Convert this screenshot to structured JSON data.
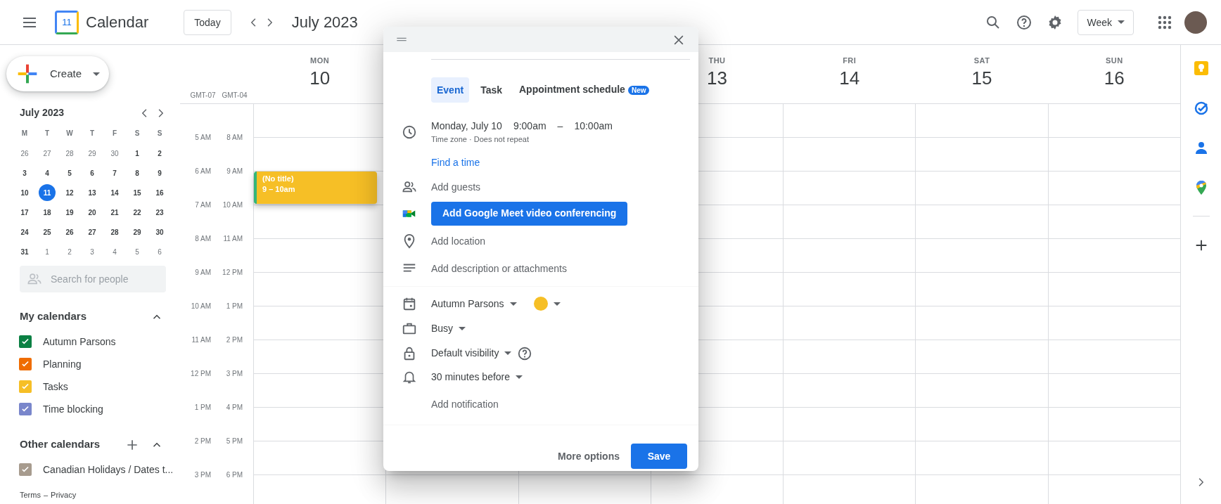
{
  "header": {
    "title": "Calendar",
    "logo_number": "11",
    "today": "Today",
    "period": "July 2023",
    "view": "Week"
  },
  "sidebar": {
    "create": "Create",
    "mini_calendar": {
      "title": "July 2023",
      "weekdays": [
        "M",
        "T",
        "W",
        "T",
        "F",
        "S",
        "S"
      ],
      "weeks": [
        [
          {
            "d": "26",
            "other_month": true,
            "selected": false
          },
          {
            "d": "27",
            "other_month": true,
            "selected": false
          },
          {
            "d": "28",
            "other_month": true,
            "selected": false
          },
          {
            "d": "29",
            "other_month": true,
            "selected": false
          },
          {
            "d": "30",
            "other_month": true,
            "selected": false
          },
          {
            "d": "1",
            "other_month": false,
            "selected": false
          },
          {
            "d": "2",
            "other_month": false,
            "selected": false
          }
        ],
        [
          {
            "d": "3",
            "other_month": false,
            "selected": false
          },
          {
            "d": "4",
            "other_month": false,
            "selected": false
          },
          {
            "d": "5",
            "other_month": false,
            "selected": false
          },
          {
            "d": "6",
            "other_month": false,
            "selected": false
          },
          {
            "d": "7",
            "other_month": false,
            "selected": false
          },
          {
            "d": "8",
            "other_month": false,
            "selected": false
          },
          {
            "d": "9",
            "other_month": false,
            "selected": false
          }
        ],
        [
          {
            "d": "10",
            "other_month": false,
            "selected": false
          },
          {
            "d": "11",
            "other_month": false,
            "selected": true
          },
          {
            "d": "12",
            "other_month": false,
            "selected": false
          },
          {
            "d": "13",
            "other_month": false,
            "selected": false
          },
          {
            "d": "14",
            "other_month": false,
            "selected": false
          },
          {
            "d": "15",
            "other_month": false,
            "selected": false
          },
          {
            "d": "16",
            "other_month": false,
            "selected": false
          }
        ],
        [
          {
            "d": "17",
            "other_month": false,
            "selected": false
          },
          {
            "d": "18",
            "other_month": false,
            "selected": false
          },
          {
            "d": "19",
            "other_month": false,
            "selected": false
          },
          {
            "d": "20",
            "other_month": false,
            "selected": false
          },
          {
            "d": "21",
            "other_month": false,
            "selected": false
          },
          {
            "d": "22",
            "other_month": false,
            "selected": false
          },
          {
            "d": "23",
            "other_month": false,
            "selected": false
          }
        ],
        [
          {
            "d": "24",
            "other_month": false,
            "selected": false
          },
          {
            "d": "25",
            "other_month": false,
            "selected": false
          },
          {
            "d": "26",
            "other_month": false,
            "selected": false
          },
          {
            "d": "27",
            "other_month": false,
            "selected": false
          },
          {
            "d": "28",
            "other_month": false,
            "selected": false
          },
          {
            "d": "29",
            "other_month": false,
            "selected": false
          },
          {
            "d": "30",
            "other_month": false,
            "selected": false
          }
        ],
        [
          {
            "d": "31",
            "other_month": false,
            "selected": false
          },
          {
            "d": "1",
            "other_month": true,
            "selected": false
          },
          {
            "d": "2",
            "other_month": true,
            "selected": false
          },
          {
            "d": "3",
            "other_month": true,
            "selected": false
          },
          {
            "d": "4",
            "other_month": true,
            "selected": false
          },
          {
            "d": "5",
            "other_month": true,
            "selected": false
          },
          {
            "d": "6",
            "other_month": true,
            "selected": false
          }
        ]
      ]
    },
    "search": {
      "placeholder": "Search for people"
    },
    "my_calendars": {
      "title": "My calendars",
      "expanded": true,
      "items": [
        {
          "label": "Autumn Parsons",
          "checked": true,
          "color": "#0b8043"
        },
        {
          "label": "Planning",
          "checked": true,
          "color": "#ef6c00"
        },
        {
          "label": "Tasks",
          "checked": true,
          "color": "#f6bf26"
        },
        {
          "label": "Time blocking",
          "checked": true,
          "color": "#7986cb"
        }
      ]
    },
    "other_calendars": {
      "title": "Other calendars",
      "expanded": true,
      "items": [
        {
          "label": "Canadian Holidays / Dates t...",
          "checked": true,
          "color": "#a79b8e"
        }
      ]
    },
    "footer": {
      "terms": "Terms",
      "separator": "–",
      "privacy": "Privacy"
    }
  },
  "week": {
    "timezones": [
      "GMT-07",
      "GMT-04"
    ],
    "days_before_dialog": [
      {
        "name": "MON",
        "date": "10"
      }
    ],
    "days_after_dialog": [
      {
        "name": "THU",
        "date": "13"
      },
      {
        "name": "FRI",
        "date": "14"
      },
      {
        "name": "SAT",
        "date": "15"
      },
      {
        "name": "SUN",
        "date": "16"
      }
    ],
    "hours": [
      {
        "left": "5 AM",
        "right": "8 AM"
      },
      {
        "left": "6 AM",
        "right": "9 AM"
      },
      {
        "left": "7 AM",
        "right": "10 AM"
      },
      {
        "left": "8 AM",
        "right": "11 AM"
      },
      {
        "left": "9 AM",
        "right": "12 PM"
      },
      {
        "left": "10 AM",
        "right": "1 PM"
      },
      {
        "left": "11 AM",
        "right": "2 PM"
      },
      {
        "left": "12 PM",
        "right": "3 PM"
      },
      {
        "left": "1 PM",
        "right": "4 PM"
      },
      {
        "left": "2 PM",
        "right": "5 PM"
      },
      {
        "left": "3 PM",
        "right": "6 PM"
      }
    ],
    "events": [
      {
        "title": "(No title)",
        "time": "9 – 10am",
        "color": "#f6bf26"
      }
    ]
  },
  "dialog": {
    "tabs": [
      {
        "label": "Event",
        "selected": true
      },
      {
        "label": "Task",
        "selected": false
      },
      {
        "label": "Appointment schedule",
        "selected": false,
        "badge": "New"
      }
    ],
    "date": "Monday, July 10",
    "start": "9:00am",
    "dash": "–",
    "end": "10:00am",
    "details": "Time zone · Does not repeat",
    "find_time": "Find a time",
    "guests": "Add guests",
    "meet": "Add Google Meet video conferencing",
    "location": "Add location",
    "description": "Add description or attachments",
    "calendar": "Autumn Parsons",
    "color": "#f6bf26",
    "availability": "Busy",
    "visibility": "Default visibility",
    "reminder": "30 minutes before",
    "add_notification": "Add notification",
    "more": "More options",
    "save": "Save"
  }
}
